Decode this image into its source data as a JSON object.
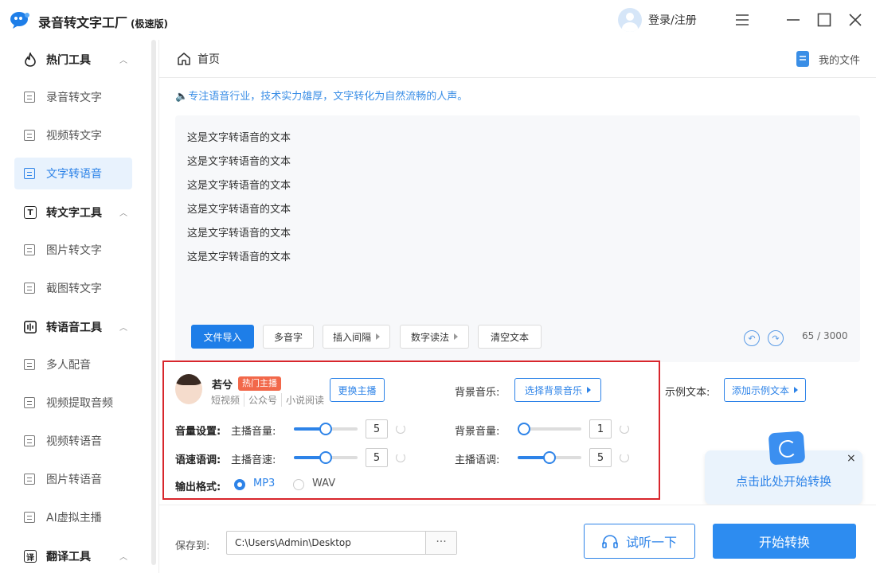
{
  "app": {
    "title": "录音转文字工厂",
    "edition": "(极速版)",
    "login": "登录/注册"
  },
  "sidebar": {
    "groups": [
      {
        "label": "热门工具"
      },
      {
        "label": "转文字工具"
      },
      {
        "label": "转语音工具"
      },
      {
        "label": "翻译工具"
      }
    ],
    "items": [
      {
        "label": "录音转文字"
      },
      {
        "label": "视频转文字"
      },
      {
        "label": "文字转语音"
      },
      {
        "label": "图片转文字"
      },
      {
        "label": "截图转文字"
      },
      {
        "label": "多人配音"
      },
      {
        "label": "视频提取音频"
      },
      {
        "label": "视频转语音"
      },
      {
        "label": "图片转语音"
      },
      {
        "label": "AI虚拟主播"
      }
    ]
  },
  "header": {
    "breadcrumb": "首页",
    "my_files": "我的文件"
  },
  "notice": "专注语音行业，技术实力雄厚，文字转化为自然流畅的人声。",
  "editor": {
    "lines": [
      "这是文字转语音的文本",
      "这是文字转语音的文本",
      "这是文字转语音的文本",
      "这是文字转语音的文本",
      "这是文字转语音的文本",
      "这是文字转语音的文本"
    ],
    "counter": "65 / 3000"
  },
  "toolbar": {
    "import": "文件导入",
    "polyphone": "多音字",
    "insert_pause": "插入间隔",
    "number_reading": "数字读法",
    "clear": "清空文本"
  },
  "anchor": {
    "name": "若兮",
    "badge": "热门主播",
    "tags": [
      "短视频",
      "公众号",
      "小说阅读"
    ],
    "change": "更换主播"
  },
  "bgm": {
    "label": "背景音乐:",
    "button": "选择背景音乐"
  },
  "sample": {
    "label": "示例文本:",
    "button": "添加示例文本"
  },
  "volume": {
    "label": "音量设置:",
    "anchor_label": "主播音量:",
    "anchor_value": "5",
    "anchor_level": 0.5,
    "bg_label": "背景音量:",
    "bg_value": "1",
    "bg_level": 0.1
  },
  "speed": {
    "label": "语速语调:",
    "speed_label": "主播音速:",
    "speed_value": "5",
    "speed_level": 0.5,
    "pitch_label": "主播语调:",
    "pitch_value": "5",
    "pitch_level": 0.5
  },
  "format": {
    "label": "输出格式:",
    "options": [
      "MP3",
      "WAV"
    ],
    "selected": "MP3"
  },
  "tip": {
    "text": "点击此处开始转换",
    "close": "×"
  },
  "footer": {
    "save_label": "保存到:",
    "path": "C:\\Users\\Admin\\Desktop",
    "browse": "···",
    "preview": "试听一下",
    "start": "开始转换"
  },
  "colors": {
    "accent": "#2d83e8",
    "hot_badge": "#f2684a",
    "highlight_box": "#d8262c"
  }
}
